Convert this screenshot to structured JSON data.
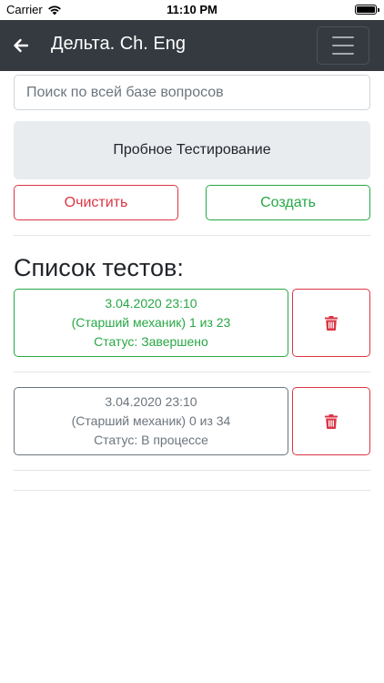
{
  "status_bar": {
    "carrier": "Carrier",
    "time": "11:10 PM",
    "wifi_icon": "wifi-icon",
    "battery_icon": "battery-icon"
  },
  "navbar": {
    "title": "Дельта. Ch. Eng",
    "back_icon": "arrow-left-icon",
    "menu_icon": "hamburger-menu-icon",
    "background_color": "#343a40"
  },
  "search": {
    "placeholder": "Поиск по всей базе вопросов",
    "value": ""
  },
  "trial_button": {
    "label": "Пробное Тестирование"
  },
  "actions": {
    "clear_label": "Очистить",
    "create_label": "Создать",
    "clear_color": "#dc3545",
    "create_color": "#28a745"
  },
  "tests_heading": "Список тестов:",
  "tests": [
    {
      "date": "3.04.2020 23:10",
      "progress": "(Старший механик) 1 из 23",
      "status": "Статус: Завершено",
      "color": "#28a745",
      "delete_icon": "trash-icon"
    },
    {
      "date": "3.04.2020 23:10",
      "progress": "(Старший механик) 0 из 34",
      "status": "Статус: В процессе",
      "color": "#6c757d",
      "delete_icon": "trash-icon"
    }
  ]
}
